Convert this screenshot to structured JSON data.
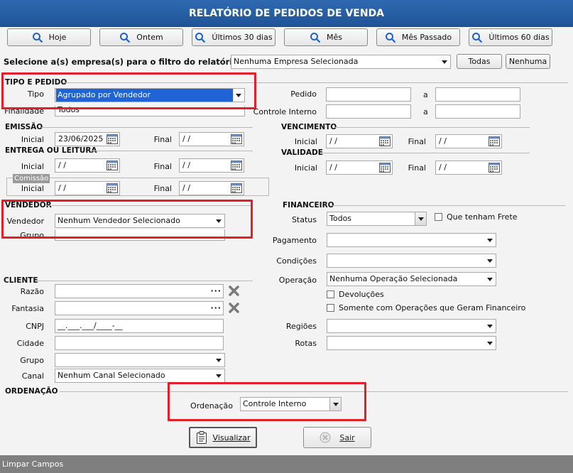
{
  "title": "RELATÓRIO DE PEDIDOS DE VENDA",
  "quick_buttons": [
    "Hoje",
    "Ontem",
    "Últimos 30 dias",
    "Mês",
    "Mês Passado",
    "Últimos 60 dias"
  ],
  "empresa": {
    "label": "Selecione a(s) empresa(s) para o filtro do relatório",
    "value": "Nenhuma Empresa Selecionada",
    "todas": "Todas",
    "nenhuma": "Nenhuma"
  },
  "tipo_pedido": {
    "section": "TIPO E PEDIDO",
    "tipo_label": "Tipo",
    "tipo_value": "Agrupado por Vendedor",
    "finalidade_label": "Finalidade",
    "finalidade_value": "Todos",
    "pedido_label": "Pedido",
    "controle_label": "Controle Interno",
    "a_label": "a",
    "pedido_from": "",
    "pedido_to": "",
    "controle_from": "",
    "controle_to": ""
  },
  "emissao": {
    "section": "EMISSÃO",
    "inicial_label": "Inicial",
    "inicial_value": "23/06/2025",
    "final_label": "Final",
    "final_value": "/ /"
  },
  "entrega": {
    "section": "ENTREGA OU LEITURA",
    "inicial_label": "Inicial",
    "inicial_value": "/ /",
    "final_label": "Final",
    "final_value": "/ /"
  },
  "comissao": {
    "chip": "Comissão",
    "inicial_label": "Inicial",
    "inicial_value": "/ /",
    "final_label": "Final",
    "final_value": "/ /"
  },
  "vencimento": {
    "section": "VENCIMENTO",
    "inicial_label": "Inicial",
    "inicial_value": "/ /",
    "final_label": "Final",
    "final_value": "/ /"
  },
  "validade": {
    "section": "VALIDADE",
    "inicial_label": "Inicial",
    "inicial_value": "/ /",
    "final_label": "Final",
    "final_value": "/ /"
  },
  "vendedor": {
    "section": "VENDEDOR",
    "vendedor_label": "Vendedor",
    "vendedor_value": "Nenhum Vendedor Selecionado",
    "grupo_label": "Grupo",
    "grupo_value": ""
  },
  "financeiro": {
    "section": "FINANCEIRO",
    "status_label": "Status",
    "status_value": "Todos",
    "frete_label": "Que tenham Frete",
    "pagamento_label": "Pagamento",
    "pagamento_value": "",
    "condicoes_label": "Condições",
    "condicoes_value": "",
    "operacao_label": "Operação",
    "operacao_value": "Nenhuma Operação Selecionada",
    "devolucoes_label": "Devoluções",
    "somente_label": "Somente com Operações que Geram Financeiro",
    "regioes_label": "Regiões",
    "regioes_value": "",
    "rotas_label": "Rotas",
    "rotas_value": ""
  },
  "cliente": {
    "section": "CLIENTE",
    "razao_label": "Razão",
    "razao_value": "",
    "fantasia_label": "Fantasia",
    "fantasia_value": "",
    "cnpj_label": "CNPJ",
    "cnpj_value": "__.___.___/____-__",
    "cidade_label": "Cidade",
    "cidade_value": "",
    "grupo_label": "Grupo",
    "grupo_value": "",
    "canal_label": "Canal",
    "canal_value": "Nenhum Canal Selecionado"
  },
  "ordenacao": {
    "section": "ORDENAÇÃO",
    "label": "Ordenação",
    "value": "Controle Interno"
  },
  "actions": {
    "visualizar": "Visualizar",
    "sair": "Sair"
  },
  "status_bar": "Limpar Campos",
  "colors": {
    "title_bg": "#2a62a8",
    "highlight_box": "#e3202a",
    "selection": "#1f63d6",
    "status_bar": "#7f7f7f"
  }
}
